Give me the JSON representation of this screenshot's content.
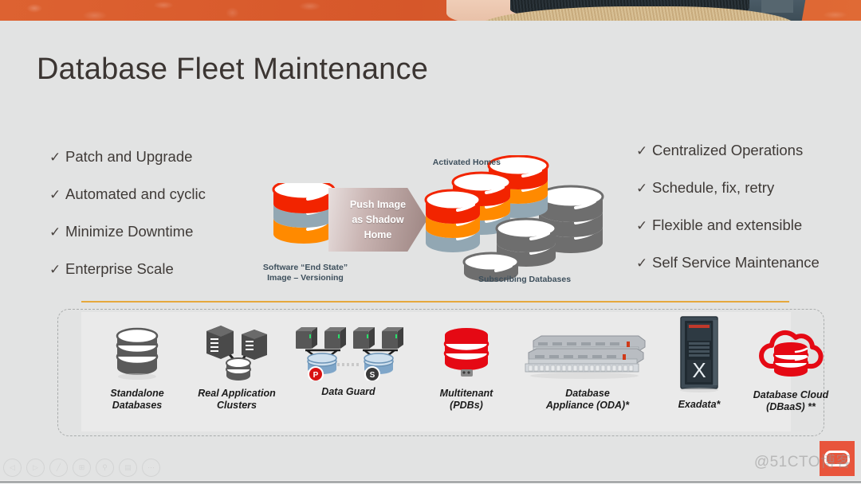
{
  "slide": {
    "title": "Database Fleet Maintenance",
    "background_color": "#e2e3e3",
    "accent_amber": "#e6a83c"
  },
  "banner": {
    "name": "decorative-illustration-strip",
    "primary_color": "#d9612f",
    "accent_color": "#3d4d57"
  },
  "bullets_left": [
    {
      "check": "✓",
      "label": "Patch and Upgrade"
    },
    {
      "check": "✓",
      "label": "Automated and cyclic"
    },
    {
      "check": "✓",
      "label": "Minimize Downtime"
    },
    {
      "check": "✓",
      "label": "Enterprise Scale"
    }
  ],
  "bullets_right": [
    {
      "check": "✓",
      "label": "Centralized Operations"
    },
    {
      "check": "✓",
      "label": "Schedule, fix, retry"
    },
    {
      "check": "✓",
      "label": "Flexible and extensible"
    },
    {
      "check": "✓",
      "label": "Self Service Maintenance"
    }
  ],
  "diagram": {
    "source_label_line1": "Software “End State”",
    "source_label_line2": "Image – Versioning",
    "arrow_line1": "Push Image",
    "arrow_line2": "as Shadow",
    "arrow_line3": "Home",
    "activated_label": "Activated Homes",
    "subscribing_label": "Subscribing Databases",
    "colors": {
      "red": "#f22400",
      "orange": "#ff8a00",
      "steel": "#92a7b3",
      "gray": "#6e6e6e",
      "arrow_from": "#e7dedd",
      "arrow_to": "#9c8481"
    }
  },
  "targets": [
    {
      "id": "standalone-databases",
      "caption": "Standalone\nDatabases",
      "icon": "database-cylinder-icon"
    },
    {
      "id": "real-application-clusters",
      "caption": "Real Application\nClusters",
      "icon": "rac-servers-icon"
    },
    {
      "id": "data-guard",
      "caption": "Data Guard",
      "icon": "data-guard-icon",
      "badge_primary": "P",
      "badge_standby": "S"
    },
    {
      "id": "multitenant-pdbs",
      "caption": "Multitenant\n(PDBs)",
      "icon": "multitenant-cylinder-icon"
    },
    {
      "id": "database-appliance-oda",
      "caption": "Database\nAppliance (ODA)*",
      "icon": "oda-rack-icon"
    },
    {
      "id": "exadata",
      "caption": "Exadata*",
      "icon": "exadata-cabinet-icon",
      "mark": "X"
    },
    {
      "id": "database-cloud-dbaas",
      "caption": "Database Cloud\n(DBaaS) **",
      "icon": "cloud-database-icon"
    }
  ],
  "toolbar": [
    {
      "id": "previous",
      "glyph": "◁"
    },
    {
      "id": "play",
      "glyph": "▷"
    },
    {
      "id": "pen",
      "glyph": "╱"
    },
    {
      "id": "layout",
      "glyph": "⊞"
    },
    {
      "id": "zoom",
      "glyph": "⚲"
    },
    {
      "id": "notes",
      "glyph": "▤"
    },
    {
      "id": "more",
      "glyph": "⋯"
    }
  ],
  "branding": {
    "logo_name": "oracle-logo",
    "logo_color": "#e8553c",
    "watermark": "@51CTO博客"
  }
}
